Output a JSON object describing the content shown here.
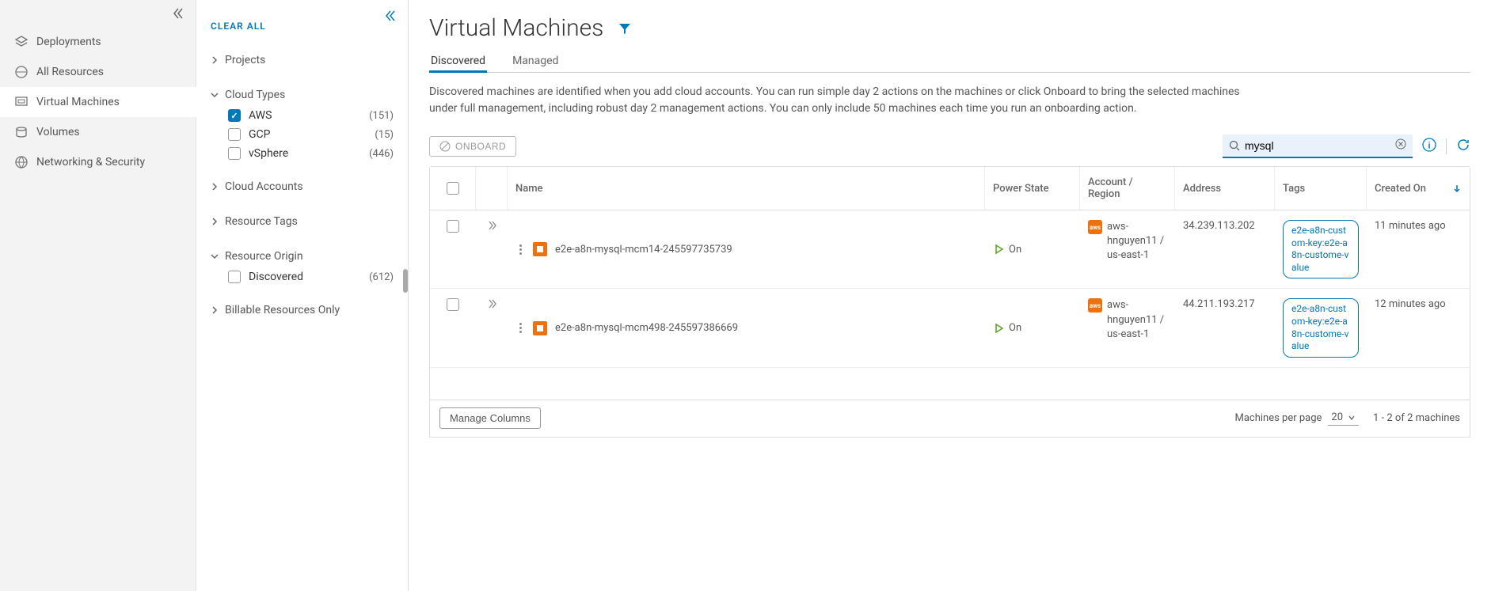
{
  "sidebar": {
    "items": [
      {
        "label": "Deployments"
      },
      {
        "label": "All Resources"
      },
      {
        "label": "Virtual Machines"
      },
      {
        "label": "Volumes"
      },
      {
        "label": "Networking & Security"
      }
    ]
  },
  "filter": {
    "clear_label": "CLEAR ALL",
    "groups": {
      "projects": "Projects",
      "cloud_types": "Cloud Types",
      "cloud_accounts": "Cloud Accounts",
      "resource_tags": "Resource Tags",
      "resource_origin": "Resource Origin",
      "billable": "Billable Resources Only"
    },
    "cloud_type_options": [
      {
        "label": "AWS",
        "count": "(151)",
        "checked": true
      },
      {
        "label": "GCP",
        "count": "(15)",
        "checked": false
      },
      {
        "label": "vSphere",
        "count": "(446)",
        "checked": false
      }
    ],
    "origin_options": [
      {
        "label": "Discovered",
        "count": "(612)",
        "checked": false
      }
    ]
  },
  "page": {
    "title": "Virtual Machines",
    "tabs": [
      {
        "label": "Discovered",
        "active": true
      },
      {
        "label": "Managed",
        "active": false
      }
    ],
    "description": "Discovered machines are identified when you add cloud accounts. You can run simple day 2 actions on the machines or click Onboard to bring the selected machines under full management, including robust day 2 management actions. You can only include 50 machines each time you run an onboarding action.",
    "onboard_label": "ONBOARD",
    "search_value": "mysql"
  },
  "table": {
    "headers": {
      "name": "Name",
      "power": "Power State",
      "account": "Account / Region",
      "address": "Address",
      "tags": "Tags",
      "created": "Created On"
    },
    "rows": [
      {
        "name": "e2e-a8n-mysql-mcm14-245597735739",
        "power": "On",
        "account": "aws-hnguyen11 / us-east-1",
        "address": "34.239.113.202",
        "tag": "e2e-a8n-custom-key:e2e-a8n-custome-value",
        "created": "11 minutes ago"
      },
      {
        "name": "e2e-a8n-mysql-mcm498-245597386669",
        "power": "On",
        "account": "aws-hnguyen11 / us-east-1",
        "address": "44.211.193.217",
        "tag": "e2e-a8n-custom-key:e2e-a8n-custome-value",
        "created": "12 minutes ago"
      }
    ],
    "footer": {
      "manage_columns": "Manage Columns",
      "per_page_label": "Machines per page",
      "per_page_value": "20",
      "range": "1 - 2 of 2 machines"
    }
  }
}
